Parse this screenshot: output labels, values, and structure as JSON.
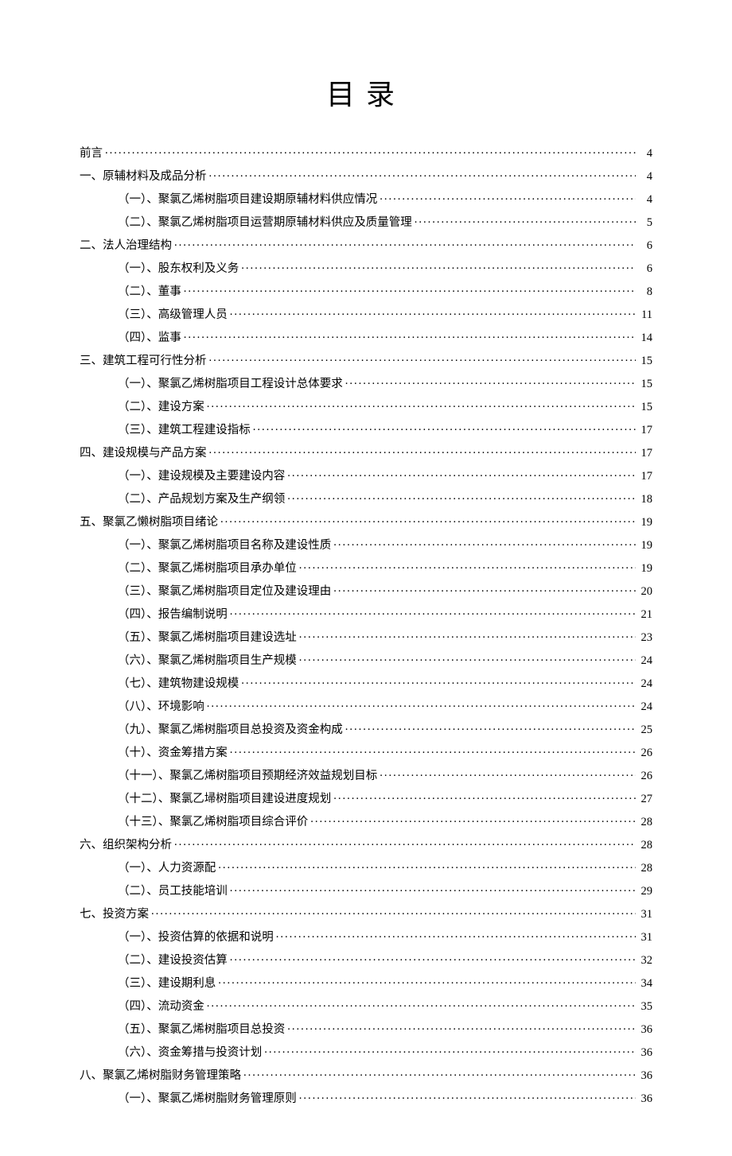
{
  "title": "目录",
  "entries": [
    {
      "level": 0,
      "label": "前言",
      "page": "4"
    },
    {
      "level": 0,
      "label": "一、原辅材料及成品分析",
      "page": "4"
    },
    {
      "level": 1,
      "label": "（一）、聚氯乙烯树脂项目建设期原辅材料供应情况",
      "page": "4"
    },
    {
      "level": 1,
      "label": "（二）、聚氯乙烯树脂项目运营期原辅材料供应及质量管理",
      "page": "5"
    },
    {
      "level": 0,
      "label": "二、法人治理结构",
      "page": "6"
    },
    {
      "level": 1,
      "label": "（一）、股东权利及义务",
      "page": "6"
    },
    {
      "level": 1,
      "label": "（二）、董事",
      "page": "8"
    },
    {
      "level": 1,
      "label": "（三）、高级管理人员",
      "page": "11"
    },
    {
      "level": 1,
      "label": "（四）、监事",
      "page": "14"
    },
    {
      "level": 0,
      "label": "三、建筑工程可行性分析",
      "page": "15"
    },
    {
      "level": 1,
      "label": "（一）、聚氯乙烯树脂项目工程设计总体要求",
      "page": "15"
    },
    {
      "level": 1,
      "label": "（二）、建设方案",
      "page": "15"
    },
    {
      "level": 1,
      "label": "（三）、建筑工程建设指标",
      "page": "17"
    },
    {
      "level": 0,
      "label": "四、建设规模与产品方案",
      "page": "17"
    },
    {
      "level": 1,
      "label": "（一）、建设规模及主要建设内容",
      "page": "17"
    },
    {
      "level": 1,
      "label": "（二）、产品规划方案及生产纲领",
      "page": "18"
    },
    {
      "level": 0,
      "label": "五、聚氯乙懒树脂项目绪论",
      "page": "19"
    },
    {
      "level": 1,
      "label": "（一）、聚氯乙烯树脂项目名称及建设性质",
      "page": "19"
    },
    {
      "level": 1,
      "label": "（二）、聚氯乙烯树脂项目承办单位",
      "page": "19"
    },
    {
      "level": 1,
      "label": "（三）、聚氯乙烯树脂项目定位及建设理由",
      "page": "20"
    },
    {
      "level": 1,
      "label": "（四）、报告编制说明",
      "page": "21"
    },
    {
      "level": 1,
      "label": "（五）、聚氯乙烯树脂项目建设选址",
      "page": "23"
    },
    {
      "level": 1,
      "label": "（六）、聚氯乙烯树脂项目生产规模",
      "page": "24"
    },
    {
      "level": 1,
      "label": "（七）、建筑物建设规模",
      "page": "24"
    },
    {
      "level": 1,
      "label": "（八）、环境影响",
      "page": "24"
    },
    {
      "level": 1,
      "label": "（九）、聚氯乙烯树脂项目总投资及资金构成",
      "page": "25"
    },
    {
      "level": 1,
      "label": "（十）、资金筹措方案",
      "page": "26"
    },
    {
      "level": 1,
      "label": "（十一）、聚氯乙烯树脂项目预期经济效益规划目标",
      "page": "26"
    },
    {
      "level": 1,
      "label": "（十二）、聚氯乙埽树脂项目建设进度规划",
      "page": "27"
    },
    {
      "level": 1,
      "label": "（十三）、聚氯乙烯树脂项目综合评价",
      "page": "28"
    },
    {
      "level": 0,
      "label": "六、组织架构分析",
      "page": "28"
    },
    {
      "level": 1,
      "label": "（一）、人力资源配",
      "page": "28"
    },
    {
      "level": 1,
      "label": "（二）、员工技能培训",
      "page": "29"
    },
    {
      "level": 0,
      "label": "七、投资方案",
      "page": "31"
    },
    {
      "level": 1,
      "label": "（一）、投资估算的依据和说明",
      "page": "31"
    },
    {
      "level": 1,
      "label": "（二）、建设投资估算",
      "page": "32"
    },
    {
      "level": 1,
      "label": "（三）、建设期利息",
      "page": "34"
    },
    {
      "level": 1,
      "label": "（四）、流动资金",
      "page": "35"
    },
    {
      "level": 1,
      "label": "（五）、聚氯乙烯树脂项目总投资",
      "page": "36"
    },
    {
      "level": 1,
      "label": "（六）、资金筹措与投资计划",
      "page": "36"
    },
    {
      "level": 0,
      "label": "八、聚氯乙烯树脂财务管理策略",
      "page": "36"
    },
    {
      "level": 1,
      "label": "（一）、聚氯乙烯树脂财务管理原则",
      "page": "36"
    }
  ]
}
